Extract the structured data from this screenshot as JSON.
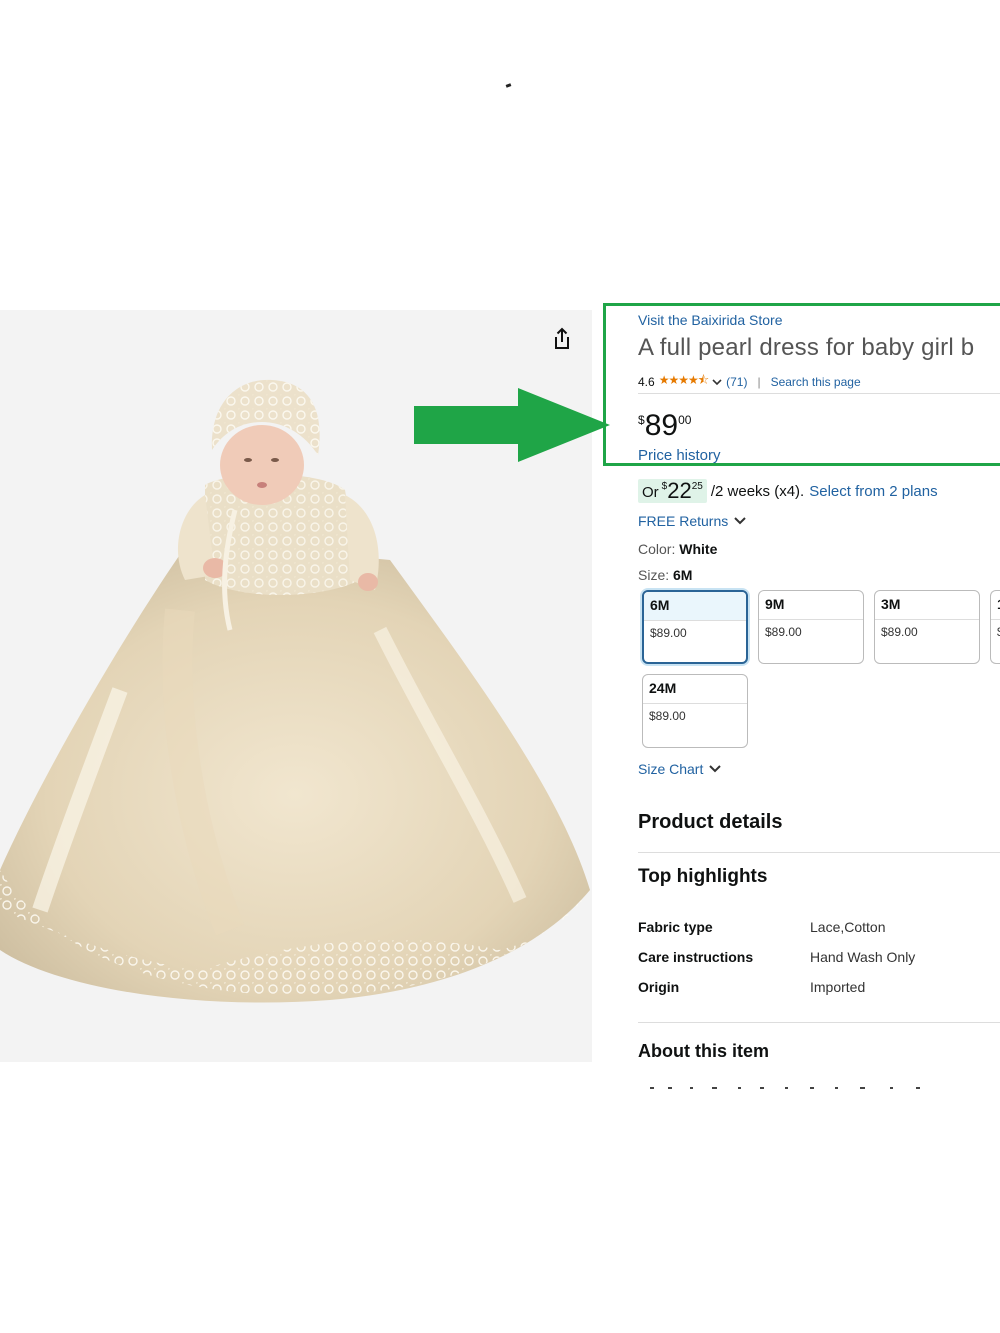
{
  "store_link": "Visit the Baixirida Store",
  "product_title": "A full pearl dress for baby girl b",
  "rating": {
    "value": "4.6",
    "stars_display": "★★★★⯪",
    "count": "(71)",
    "search_link": "Search this page"
  },
  "price": {
    "symbol": "$",
    "whole": "89",
    "fraction": "00"
  },
  "price_history": "Price history",
  "installment": {
    "prefix": "Or",
    "symbol": "$",
    "whole": "22",
    "fraction": "25",
    "term": "/2 weeks (x4).",
    "plans_link": "Select from 2 plans"
  },
  "free_returns": "FREE Returns",
  "color": {
    "label": "Color:",
    "value": "White"
  },
  "size": {
    "label": "Size:",
    "value": "6M"
  },
  "size_options": [
    {
      "label": "6M",
      "price": "$89.00",
      "selected": true
    },
    {
      "label": "9M",
      "price": "$89.00",
      "selected": false
    },
    {
      "label": "3M",
      "price": "$89.00",
      "selected": false
    },
    {
      "label": "1",
      "price": "$",
      "selected": false
    },
    {
      "label": "24M",
      "price": "$89.00",
      "selected": false
    }
  ],
  "size_chart": "Size Chart",
  "product_details_title": "Product details",
  "top_highlights_title": "Top highlights",
  "highlights": [
    {
      "label": "Fabric type",
      "value": "Lace,Cotton"
    },
    {
      "label": "Care instructions",
      "value": "Hand Wash Only"
    },
    {
      "label": "Origin",
      "value": "Imported"
    }
  ],
  "about_title": "About this item",
  "colors": {
    "link": "#2162a1",
    "highlight_border": "#1fa547",
    "arrow": "#1fa547",
    "star": "#e67a00",
    "selected_border": "#2a6496"
  },
  "icons": [
    "share-icon",
    "chevron-down-icon",
    "star-icon",
    "arrow-right-icon"
  ]
}
